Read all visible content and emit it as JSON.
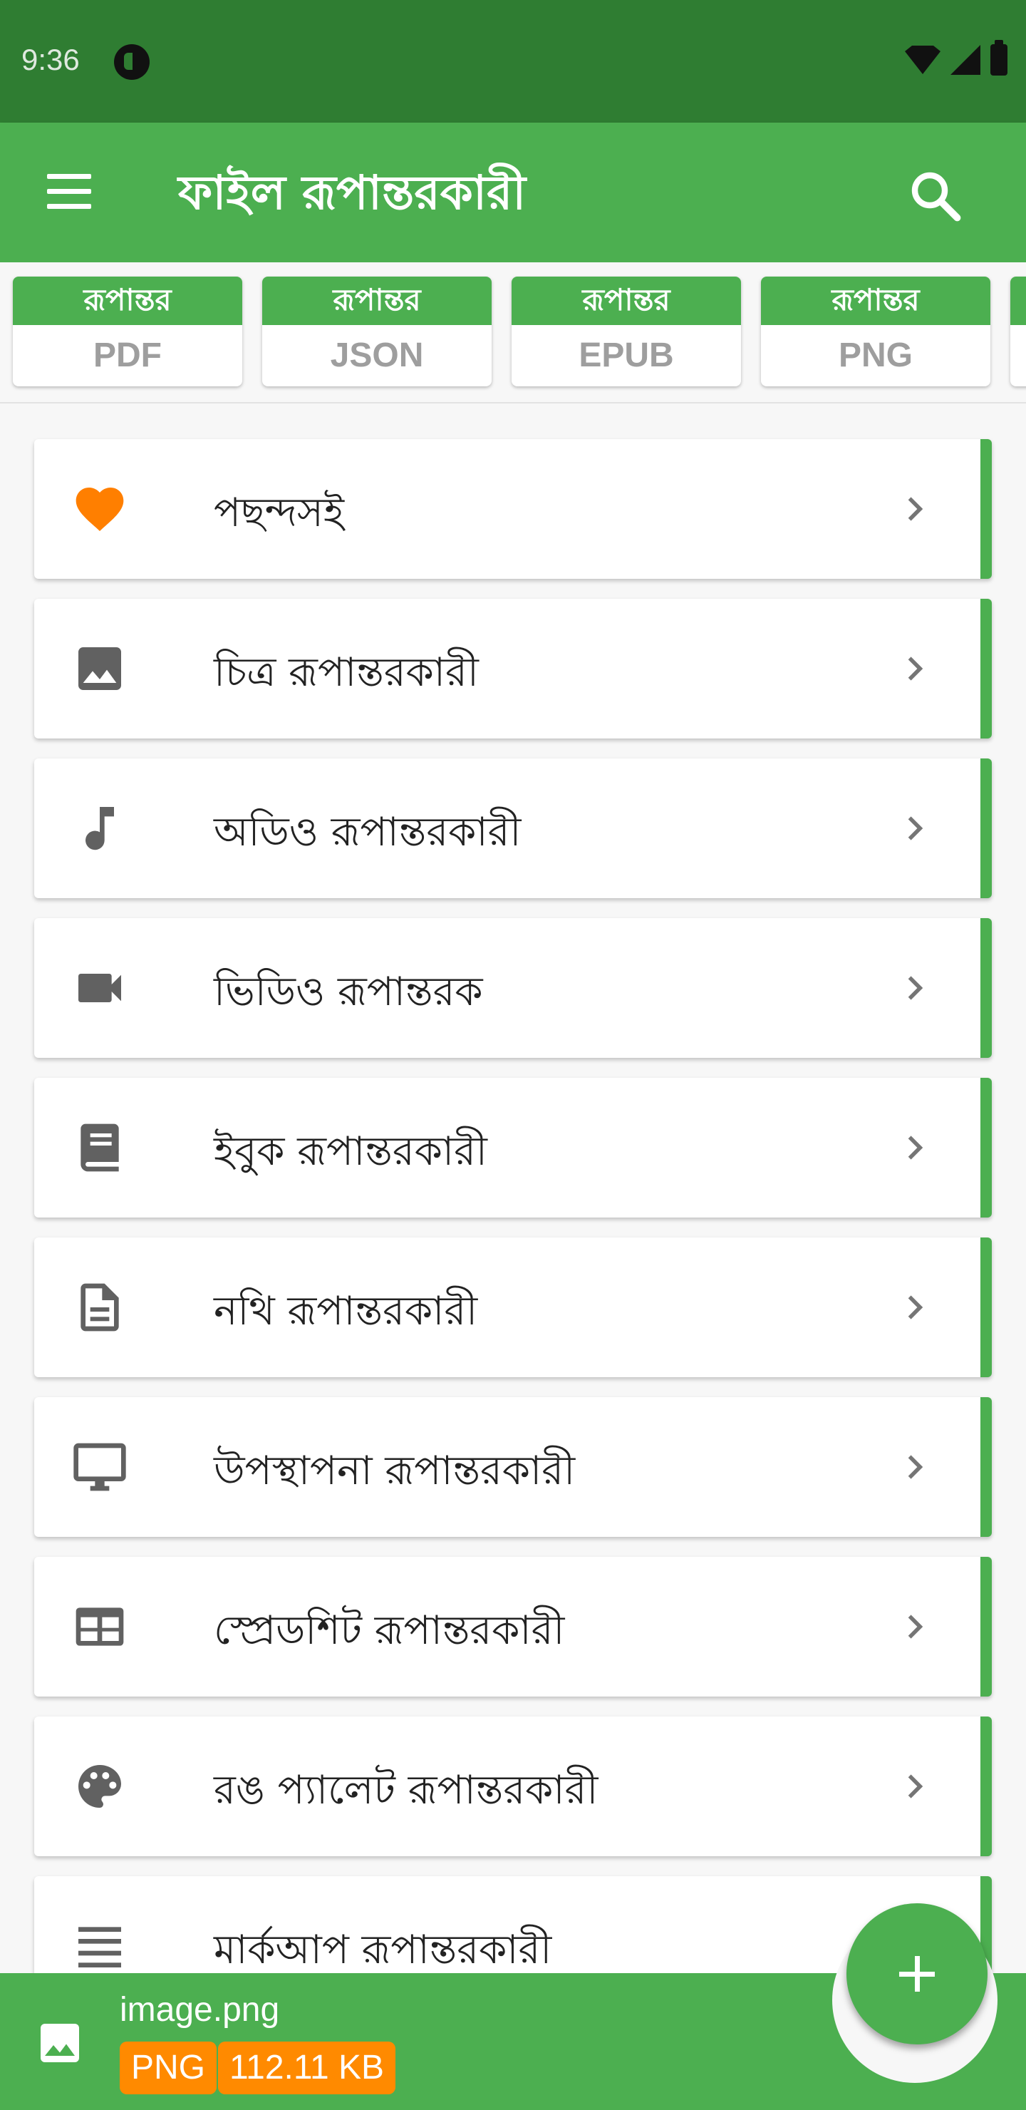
{
  "status_bar": {
    "time": "9:36"
  },
  "app_bar": {
    "title": "ফাইল রূপান্তরকারী"
  },
  "chips": [
    {
      "top": "রূপান্তর",
      "format": "PDF"
    },
    {
      "top": "রূপান্তর",
      "format": "JSON"
    },
    {
      "top": "রূপান্তর",
      "format": "EPUB"
    },
    {
      "top": "রূপান্তর",
      "format": "PNG"
    }
  ],
  "list": [
    {
      "label": "পছন্দসই",
      "icon": "heart-icon",
      "icon_color": "#ff7f00"
    },
    {
      "label": "চিত্র রূপান্তরকারী",
      "icon": "image-icon"
    },
    {
      "label": "অডিও রূপান্তরকারী",
      "icon": "music-note-icon"
    },
    {
      "label": "ভিডিও রূপান্তরক",
      "icon": "video-camera-icon"
    },
    {
      "label": "ইবুক রূপান্তরকারী",
      "icon": "book-icon"
    },
    {
      "label": "নথি রূপান্তরকারী",
      "icon": "document-icon"
    },
    {
      "label": "উপস্থাপনা রূপান্তরকারী",
      "icon": "monitor-icon"
    },
    {
      "label": "স্প্রেডশিট রূপান্তরকারী",
      "icon": "table-icon"
    },
    {
      "label": "রঙ প্যালেট রূপান্তরকারী",
      "icon": "palette-icon"
    },
    {
      "label": "মার্কআপ রূপান্তরকারী",
      "icon": "lines-icon"
    }
  ],
  "bottom": {
    "file_name": "image.png",
    "file_type": "PNG",
    "file_size": "112.11 KB"
  },
  "colors": {
    "primary": "#4caf50",
    "status_bar": "#2f7d32",
    "accent": "#ff8a00",
    "icon_gray": "#616161"
  }
}
